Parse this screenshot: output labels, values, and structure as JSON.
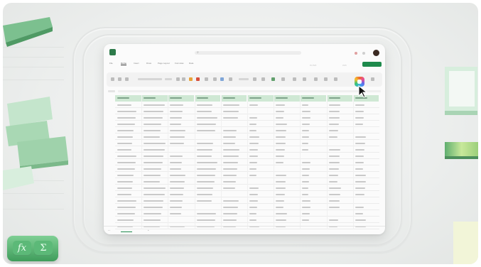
{
  "window": {
    "menus": [
      "File",
      "Home",
      "Insert",
      "Draw",
      "Page Layout",
      "Formulas",
      "Data"
    ],
    "active_menu": "Home",
    "share_label": "",
    "search_placeholder": ""
  },
  "ribbon": {
    "copilot_icon": "copilot-icon"
  },
  "sheet": {
    "columns": 10,
    "rows": 20,
    "tabs": [
      "",
      ""
    ]
  },
  "decor": {
    "function_keys": [
      "fx",
      "Σ"
    ]
  },
  "colors": {
    "accent": "#1e8a4c",
    "header_fill": "#cfe8d4",
    "background": "#eceeed"
  }
}
